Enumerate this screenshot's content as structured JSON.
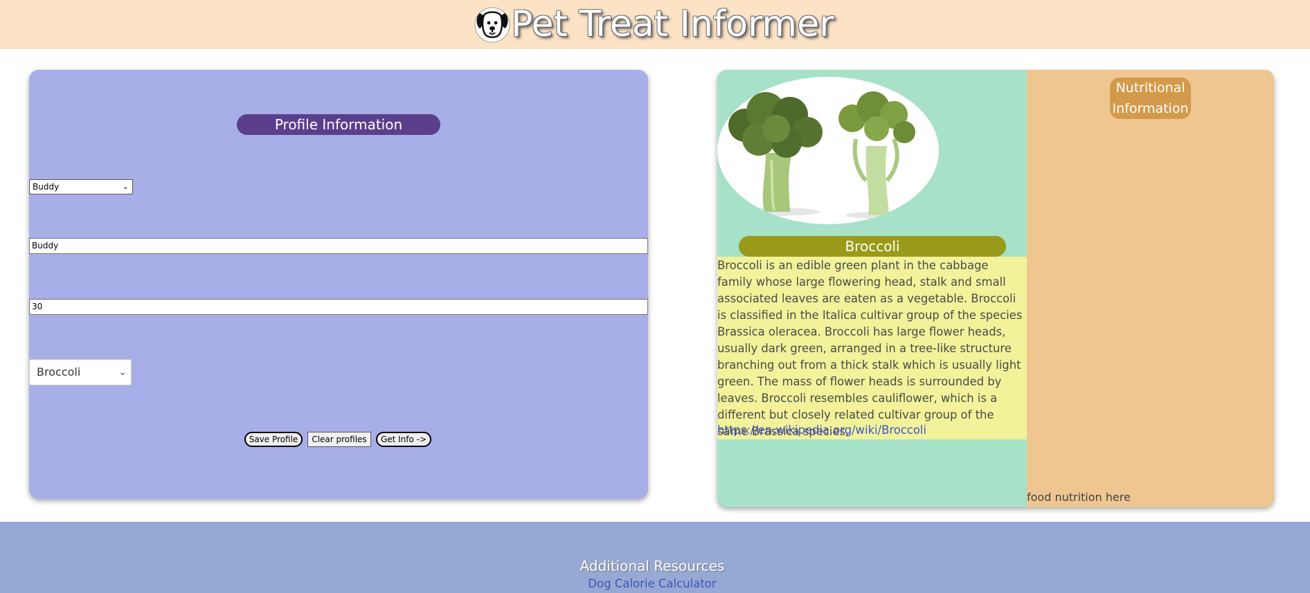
{
  "app": {
    "title": "Pet Treat Informer",
    "logo_icon": "dog-face-icon"
  },
  "profile": {
    "heading": "Profile Information",
    "pet_select_value": "Buddy",
    "name_value": "Buddy",
    "weight_value": "30",
    "food_select_value": "Broccoli",
    "buttons": {
      "save": "Save Profile",
      "clear": "Clear profiles",
      "get_info": "Get Info ->"
    }
  },
  "food": {
    "name": "Broccoli",
    "image_icon": "broccoli-image",
    "description": "Broccoli is an edible green plant in the cabbage family whose large flowering head, stalk and small associated leaves are eaten as a vegetable. Broccoli is classified in the Italica cultivar group of the species Brassica oleracea. Broccoli has large flower heads, usually dark green, arranged in a tree-like structure branching out from a thick stalk which is usually light green. The mass of flower heads is surrounded by leaves. Broccoli resembles cauliflower, which is a different but closely related cultivar group of the same Brassica species.",
    "link": "https://en.wikipedia.org/wiki/Broccoli"
  },
  "nutrition": {
    "heading": "Nutritional Information",
    "placeholder": "food nutrition here"
  },
  "footer": {
    "title": "Additional Resources",
    "link": "Dog Calorie Calculator"
  },
  "colors": {
    "header_bg": "#fde3c6",
    "profile_card": "#a7aee8",
    "profile_pill": "#5b3f8c",
    "info_card": "#a6e1c8",
    "food_pill": "#9a9a1a",
    "description_bg": "#f2f29a",
    "nutrition_bg": "#efc690",
    "nutrition_pill": "#d39a4c",
    "footer_bg": "#96a9d4",
    "link": "#3c56c8"
  }
}
